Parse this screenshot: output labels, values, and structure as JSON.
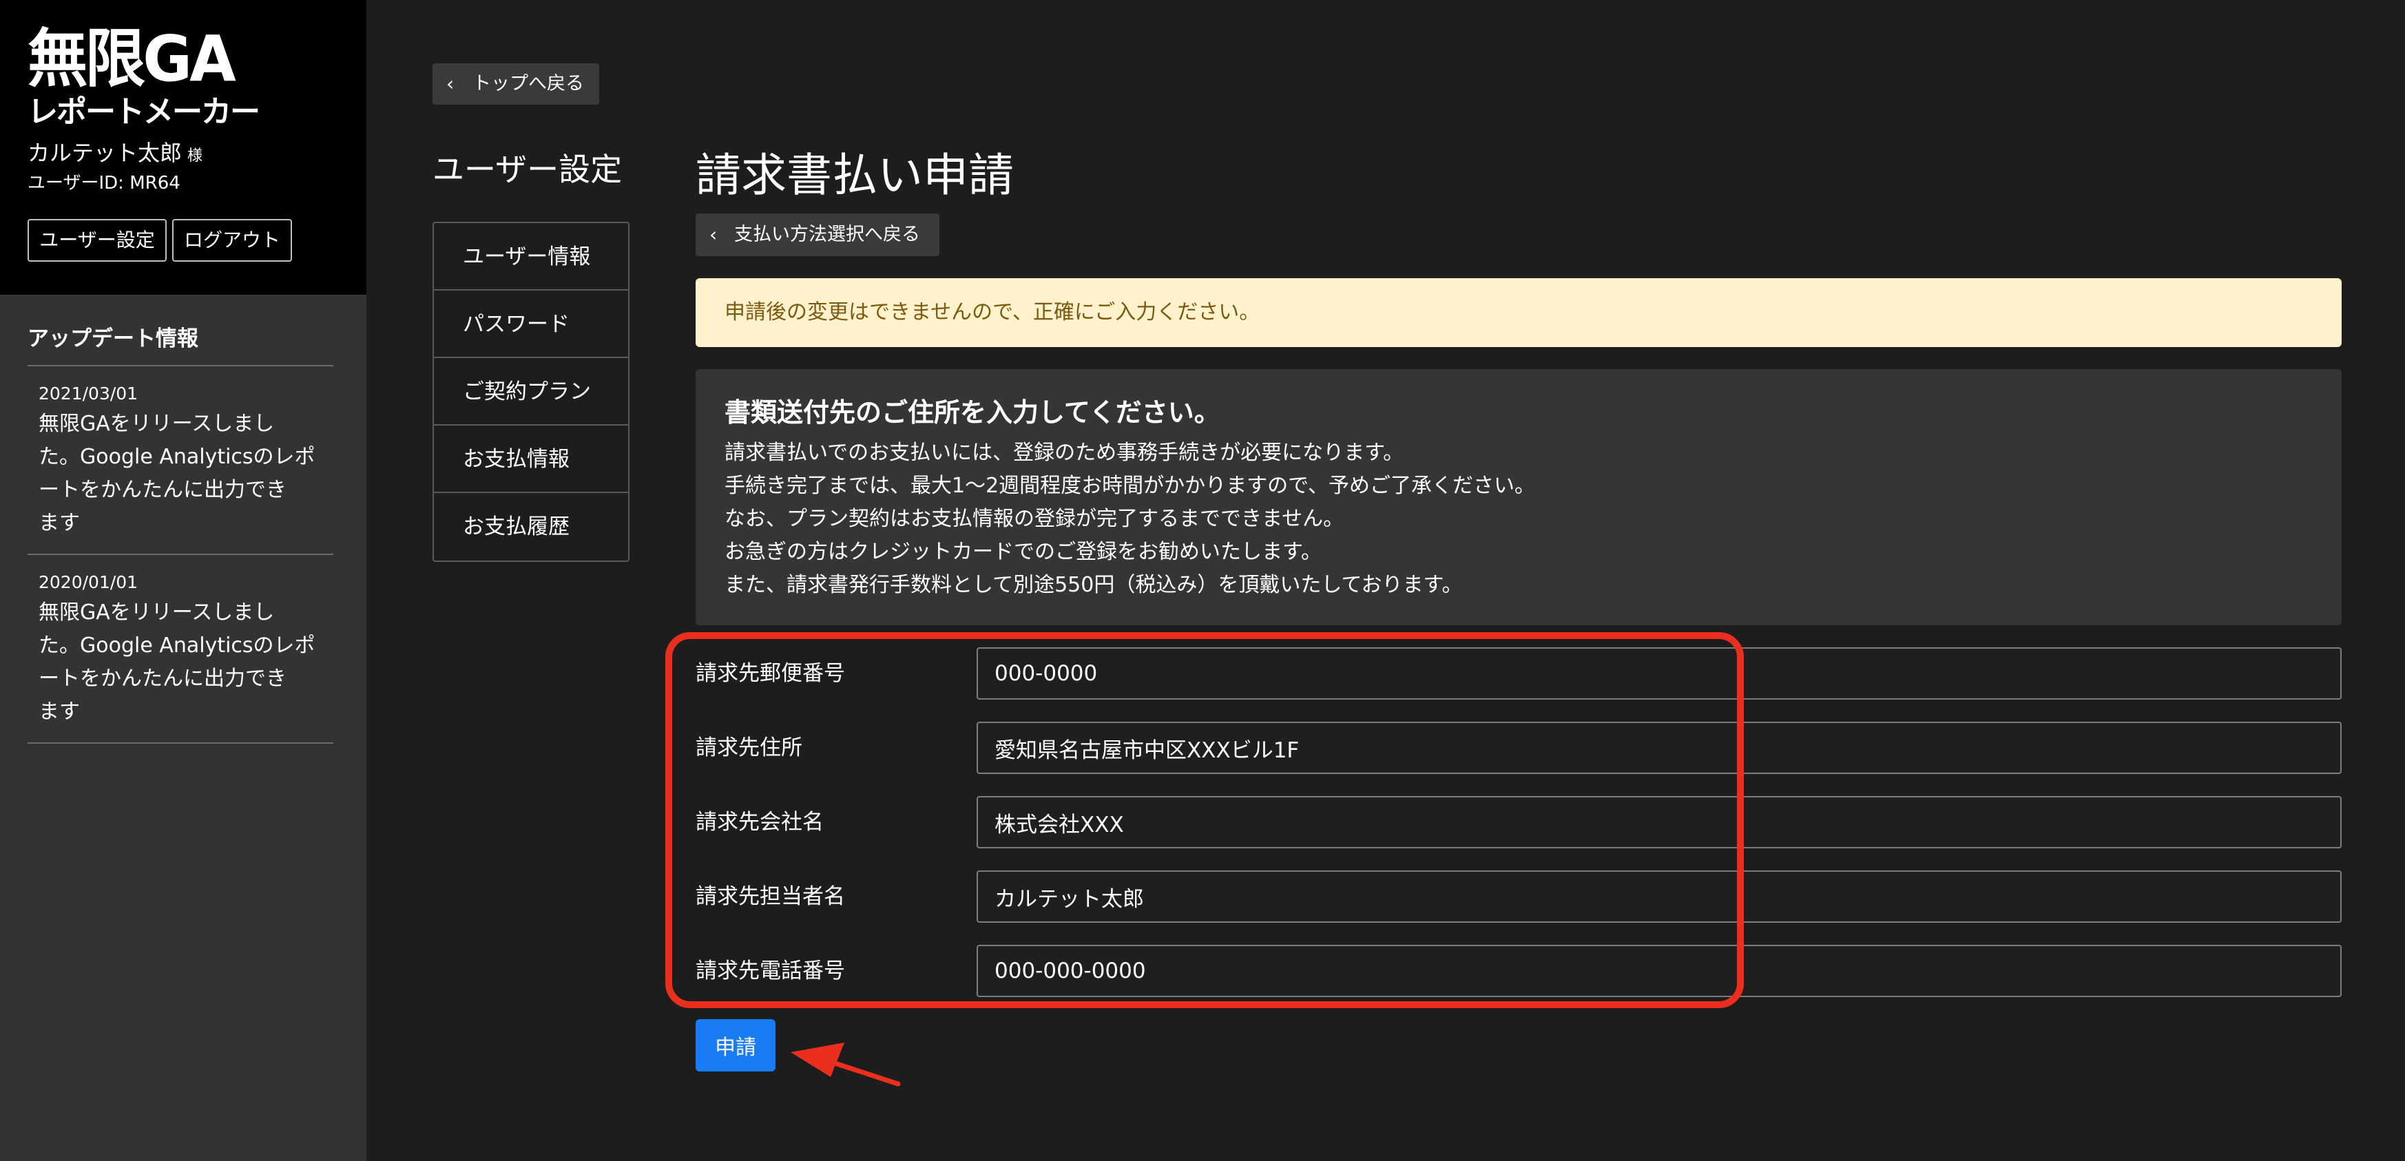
{
  "sidebar": {
    "logo_main": "無限GA",
    "logo_sub": "レポートメーカー",
    "user_name": "カルテット太郎",
    "honorific": "様",
    "user_id": "ユーザーID: MR64",
    "settings_button": "ユーザー設定",
    "logout_button": "ログアウト",
    "updates_title": "アップデート情報",
    "updates": [
      {
        "date": "2021/03/01",
        "lines": [
          "無限GAをリリースしまし",
          "た。Google Analyticsのレポ",
          "ートをかんたんに出力でき",
          "ます"
        ]
      },
      {
        "date": "2020/01/01",
        "lines": [
          "無限GAをリリースしまし",
          "た。Google Analyticsのレポ",
          "ートをかんたんに出力でき",
          "ます"
        ]
      }
    ]
  },
  "nav": {
    "back_top": "トップへ戻る",
    "title": "ユーザー設定",
    "items": [
      "ユーザー情報",
      "パスワード",
      "ご契約プラン",
      "お支払情報",
      "お支払履歴"
    ]
  },
  "main": {
    "title": "請求書払い申請",
    "back_method": "支払い方法選択へ戻る",
    "alert": "申請後の変更はできませんので、正確にご入力ください。",
    "info": {
      "title": "書類送付先のご住所を入力してください。",
      "lines": [
        "請求書払いでのお支払いには、登録のため事務手続きが必要になります。",
        "手続き完了までは、最大1〜2週間程度お時間がかかりますので、予めご了承ください。",
        "なお、プラン契約はお支払情報の登録が完了するまでできません。",
        "お急ぎの方はクレジットカードでのご登録をお勧めいたします。",
        "また、請求書発行手数料として別途550円（税込み）を頂戴いたしております。"
      ]
    },
    "form": [
      {
        "label": "請求先郵便番号",
        "value": "000-0000"
      },
      {
        "label": "請求先住所",
        "value": "愛知県名古屋市中区XXXビル1F"
      },
      {
        "label": "請求先会社名",
        "value": "株式会社XXX"
      },
      {
        "label": "請求先担当者名",
        "value": "カルテット太郎"
      },
      {
        "label": "請求先電話番号",
        "value": "000-000-0000"
      }
    ],
    "submit": "申請"
  },
  "colors": {
    "accent": "#1a7cf4",
    "annotation": "#ea2f1f",
    "alert_bg": "#fff2cc",
    "alert_text": "#7c5a10"
  }
}
